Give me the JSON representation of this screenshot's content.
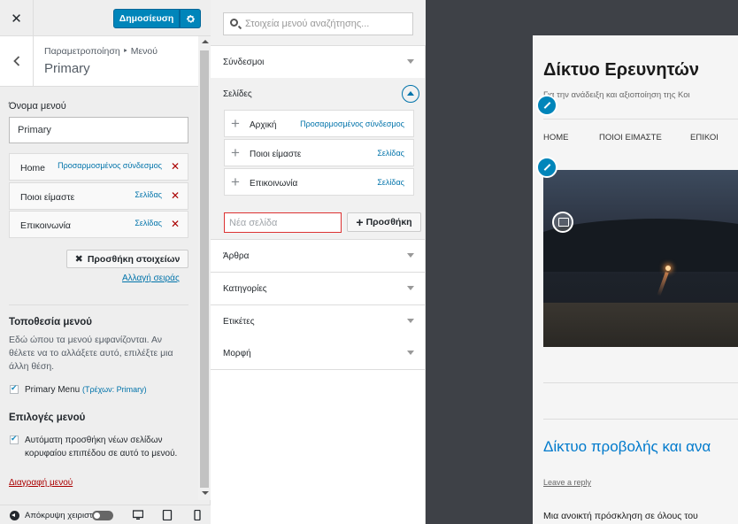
{
  "header": {
    "close_label": "✕",
    "publish_label": "Δημοσίευση"
  },
  "section": {
    "breadcrumb": "Παραμετροποίηση ‣ Μενού",
    "title": "Primary"
  },
  "menu_name": {
    "label": "Όνομα μενού",
    "value": "Primary"
  },
  "menu_items": [
    {
      "title": "Home",
      "type": "Προσαρμοσμένος σύνδεσμος"
    },
    {
      "title": "Ποιοι είμαστε",
      "type": "Σελίδας"
    },
    {
      "title": "Επικοινωνία",
      "type": "Σελίδας"
    }
  ],
  "actions": {
    "add_items": "Προσθήκη στοιχείων",
    "reorder": "Αλλαγή σειράς",
    "delete_menu": "Διαγραφή μενού"
  },
  "location": {
    "heading": "Τοποθεσία μενού",
    "description": [
      "Εδώ ώπου τα μενού εμφανίζονται. Αν",
      "θέλετε να το αλλάξετε αυτό, επιλέξτε μια",
      "άλλη θέση."
    ],
    "primary_label": "Primary Menu",
    "primary_note": "(Τρέχων: Primary)"
  },
  "options": {
    "heading": "Επιλογές μενού",
    "auto_add_line1": "Αυτόματη προσθήκη νέων σελίδων",
    "auto_add_line2": "κορυφαίου επιπέδου σε αυτό το μενού."
  },
  "footer": {
    "collapse_label": "Απόκρυψη χειριστ"
  },
  "available": {
    "search_placeholder": "Στοιχεία μενού αναζήτησης...",
    "sections": {
      "links": "Σύνδεσμοι",
      "pages": "Σελίδες",
      "posts": "Άρθρα",
      "categories": "Κατηγορίες",
      "tags": "Ετικέτες",
      "format": "Μορφή"
    },
    "pages": [
      {
        "title": "Αρχική",
        "type": "Προσαρμοσμένος σύνδεσμος"
      },
      {
        "title": "Ποιοι είμαστε",
        "type": "Σελίδας"
      },
      {
        "title": "Επικοινωνία",
        "type": "Σελίδας"
      }
    ],
    "new_page_placeholder": "Νέα σελίδα",
    "add_label": "Προσθήκη"
  },
  "preview": {
    "site_title": "Δίκτυο Ερευνητών",
    "site_description": "Για την ανάδειξη και αξιοποίηση της Κοι",
    "nav": [
      "HOME",
      "ΠΟΙΟΙ ΕΙΜΑΣΤΕ",
      "ΕΠΙΚΟΙ"
    ],
    "post_title": "Δίκτυο προβολής και ανα",
    "leave_reply": "Leave a reply",
    "excerpt": "Μια ανοικτή πρόσκληση σε όλους του"
  },
  "colors": {
    "accent": "#0085ba",
    "link": "#0073aa",
    "delete": "#aa0000"
  }
}
